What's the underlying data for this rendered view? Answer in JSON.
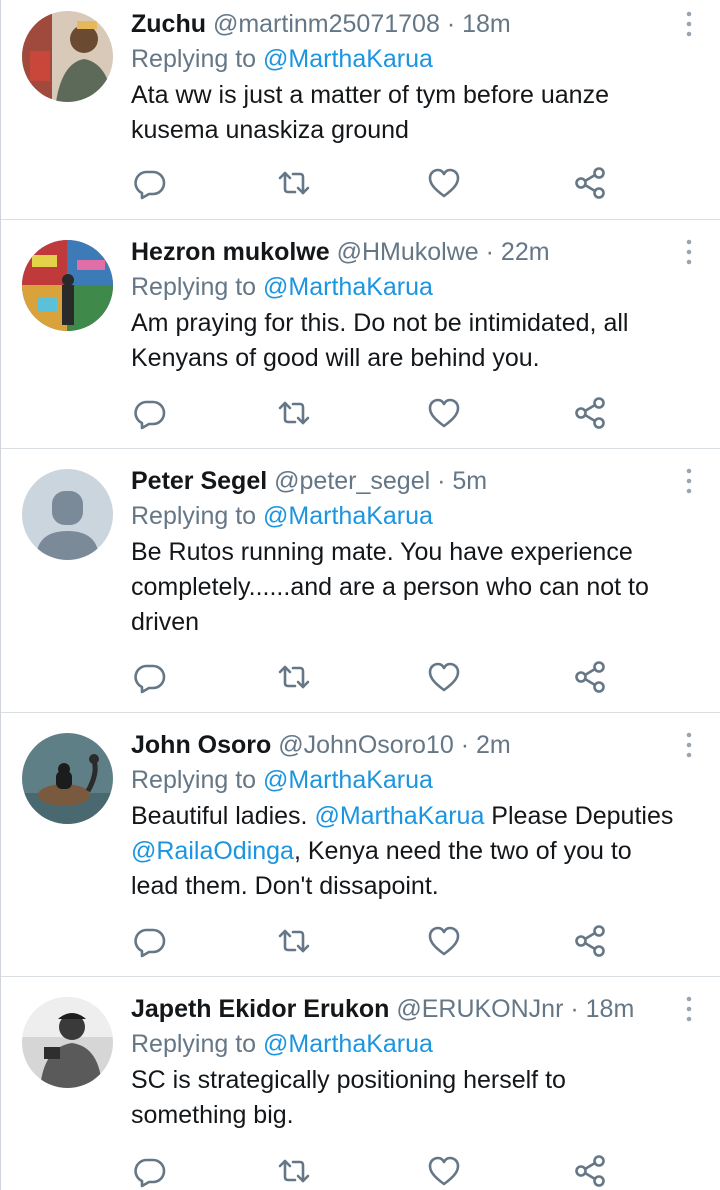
{
  "colors": {
    "link": "#1b95e0",
    "secondary_text": "#657786",
    "primary_text": "#14171a",
    "divider": "#d9dee3"
  },
  "tweets": [
    {
      "name": "Zuchu",
      "handle": "@martinm25071708",
      "separator": "·",
      "time": "18m",
      "reply_prefix": "Replying to",
      "reply_to": "@MarthaKarua",
      "text": "Ata ww is just a matter of tym before uanze kusema unaskiza  ground"
    },
    {
      "name": "Hezron mukolwe",
      "handle": "@HMukolwe",
      "separator": "·",
      "time": "22m",
      "reply_prefix": "Replying to",
      "reply_to": "@MarthaKarua",
      "text": "Am praying for this. Do not be intimidated, all Kenyans of good will are behind you."
    },
    {
      "name": "Peter Segel",
      "handle": "@peter_segel",
      "separator": "·",
      "time": "5m",
      "reply_prefix": "Replying to",
      "reply_to": "@MarthaKarua",
      "text": "Be Rutos running mate. You have experience completely......and are a person who can not to driven"
    },
    {
      "name": "John Osoro",
      "handle": "@JohnOsoro10",
      "separator": "·",
      "time": "2m",
      "reply_prefix": "Replying to",
      "reply_to": "@MarthaKarua",
      "text_parts": [
        "Beautiful ladies. ",
        "@MarthaKarua",
        " Please Deputies ",
        "@RailaOdinga",
        ", Kenya need the two of you to lead them. Don't dissapoint."
      ]
    },
    {
      "name": "Japeth Ekidor Erukon",
      "handle": "@ERUKONJnr",
      "separator": "·",
      "time": "18m",
      "reply_prefix": "Replying to",
      "reply_to": "@MarthaKarua",
      "text": "SC is strategically positioning herself to something big."
    }
  ]
}
